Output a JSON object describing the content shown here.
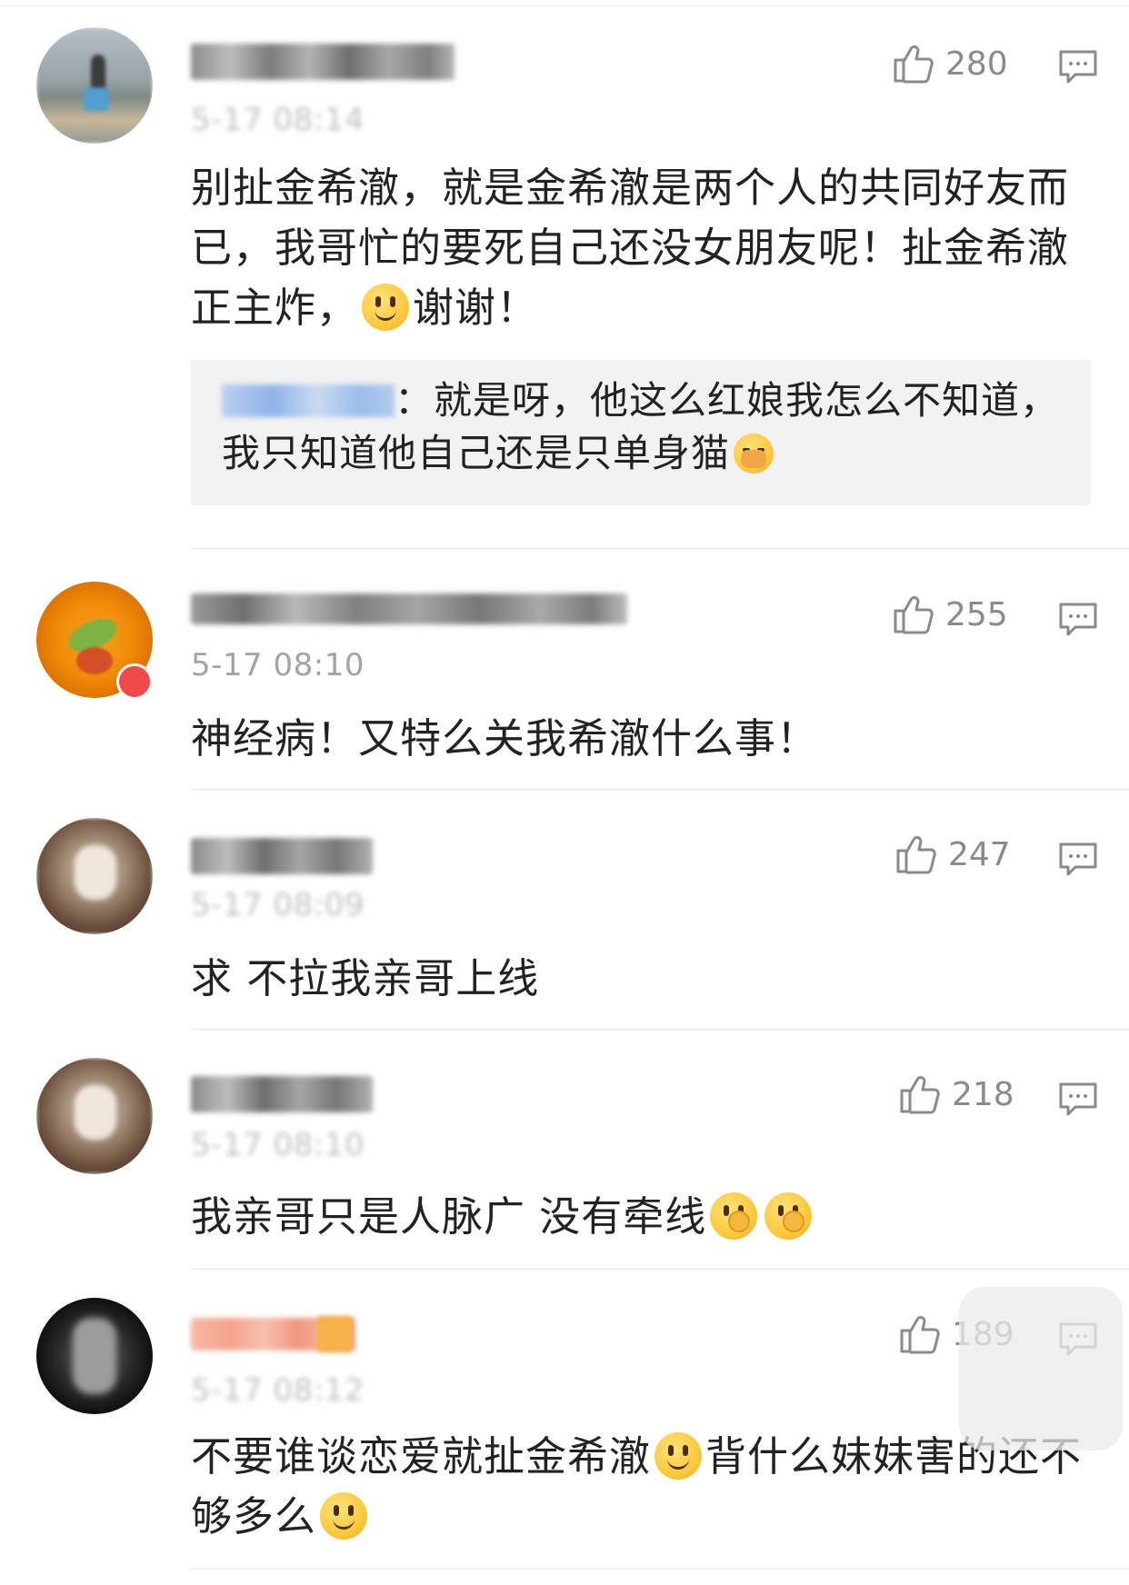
{
  "comments": [
    {
      "time": "5-17 08:14",
      "likes": "280",
      "text_parts": [
        "别扯金希澈，就是金希澈是两个人的共同好友而已，我哥忙的要死自己还没女朋友呢！扯金希澈正主炸，",
        "谢谢！"
      ],
      "emoji": "smile-emoji",
      "reply": {
        "text_parts": [
          "：就是呀，他这么红娘我怎么不知道，我只知道他自己还是只单身猫"
        ],
        "emoji": "shy-emoji"
      }
    },
    {
      "time": "5-17 08:10",
      "likes": "255",
      "text": "神经病！又特么关我希澈什么事！"
    },
    {
      "time": "5-17 08:09",
      "likes": "247",
      "text": "求 不拉我亲哥上线"
    },
    {
      "time": "5-17 08:10",
      "likes": "218",
      "text": "我亲哥只是人脉广 没有牵线",
      "emoji": "thinking-emoji"
    },
    {
      "time": "5-17 08:12",
      "likes": "189",
      "text_parts": [
        "不要谁谈恋爱就扯金希澈",
        "背什么妹妹害的还不够多么"
      ],
      "emoji": "smile-emoji"
    }
  ],
  "colors": {
    "text": "#222222",
    "meta": "#a3a3a3",
    "reply_bg": "#f2f2f2",
    "divider": "#e6e6e6"
  },
  "icons": [
    "like-icon",
    "reply-icon"
  ]
}
